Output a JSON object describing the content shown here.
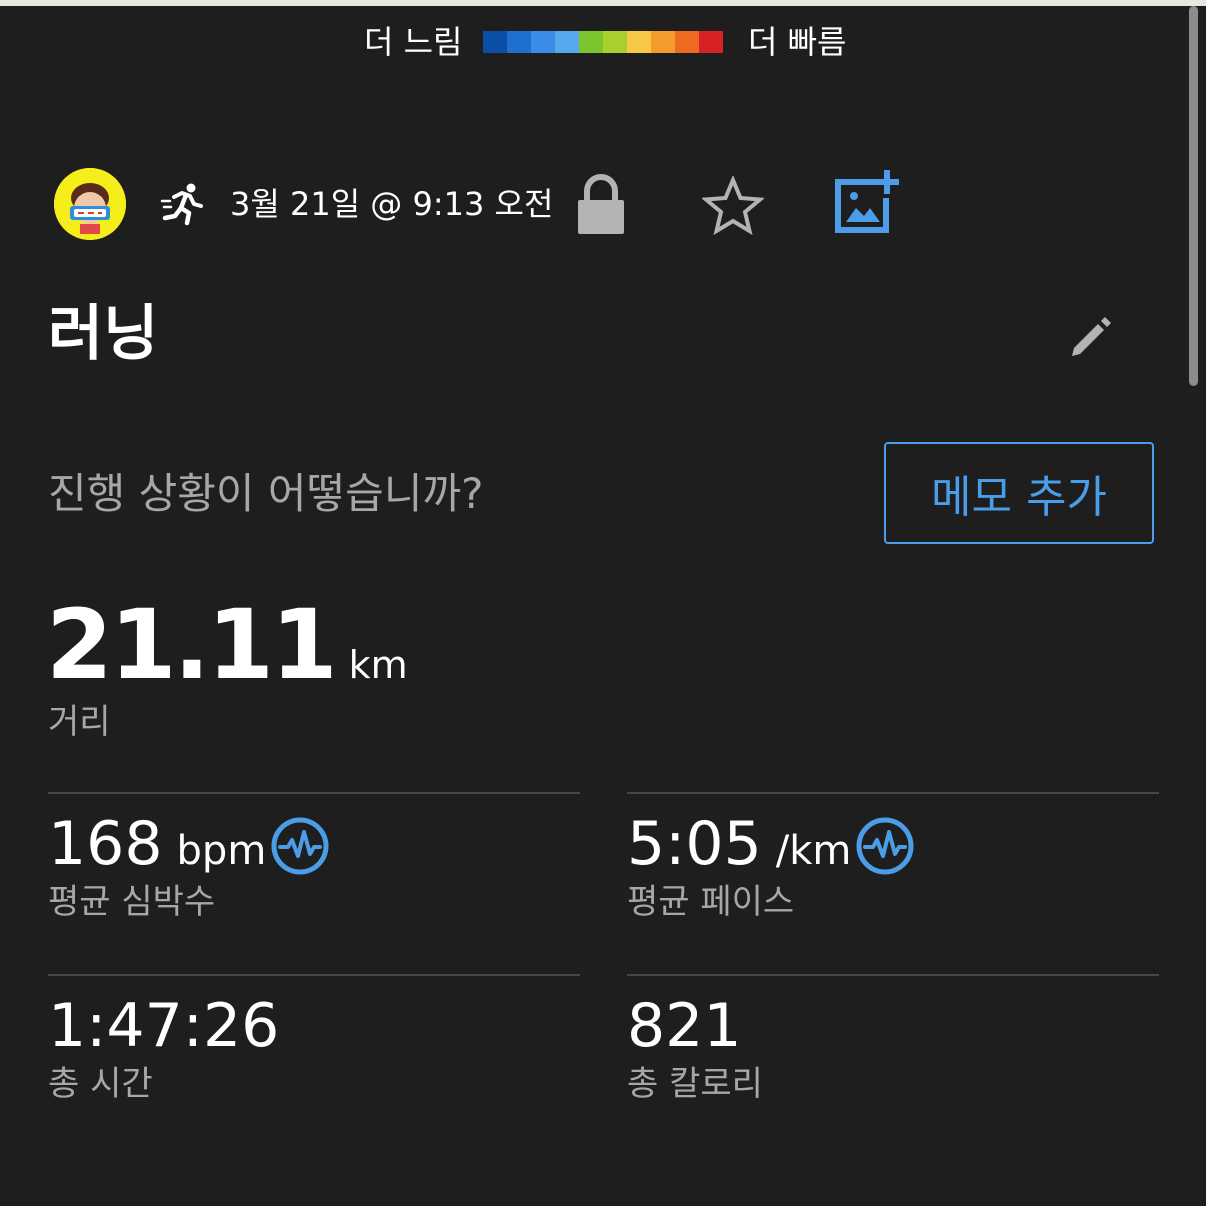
{
  "legend": {
    "slow_label": "더 느림",
    "fast_label": "더 빠름",
    "colors": [
      "#0a4fa5",
      "#1f6fd1",
      "#3b8ce6",
      "#58a8f0",
      "#7cc42b",
      "#a9cf2f",
      "#f7c845",
      "#f59b2c",
      "#ee6a21",
      "#d92224"
    ]
  },
  "header": {
    "activity_icon": "running-icon",
    "date": "3월 21일 @ 9:13 오전",
    "lock_icon": "lock-icon",
    "star_icon": "star-icon",
    "photo_icon": "add-photo-icon"
  },
  "activity": {
    "title": "러닝",
    "edit_icon": "pencil-icon"
  },
  "memo": {
    "prompt": "진행 상황이 어떻습니까?",
    "button_label": "메모 추가"
  },
  "distance": {
    "value": "21.11",
    "unit": "km",
    "label": "거리"
  },
  "stats": [
    {
      "value": "168",
      "unit": "bpm",
      "label": "평균 심박수",
      "icon": "heart-rate-icon"
    },
    {
      "value": "5:05",
      "unit": "/km",
      "label": "평균 페이스",
      "icon": "heart-rate-icon"
    },
    {
      "value": "1:47:26",
      "unit": "",
      "label": "총 시간"
    },
    {
      "value": "821",
      "unit": "",
      "label": "총 칼로리"
    }
  ],
  "colors": {
    "background": "#1e1e1f",
    "accent": "#4a9de6",
    "secondary_text": "#a7a7a7"
  }
}
